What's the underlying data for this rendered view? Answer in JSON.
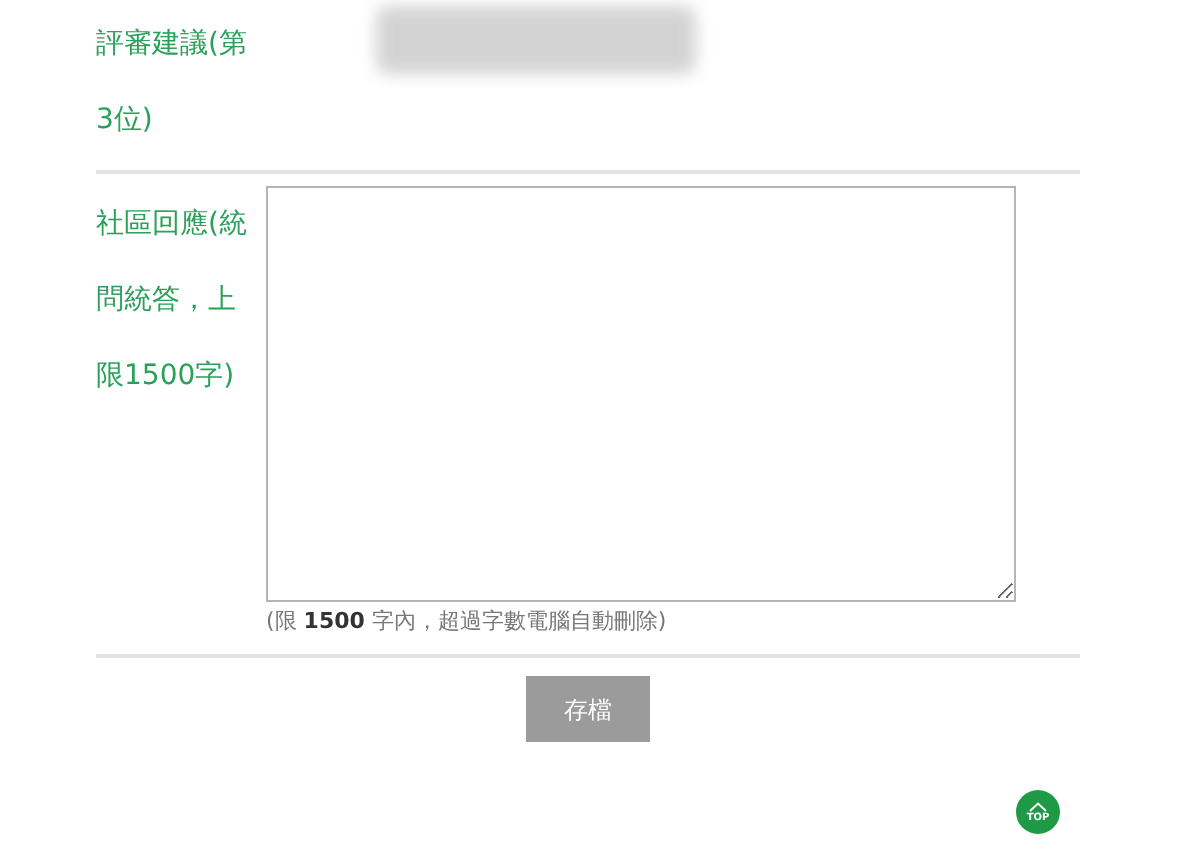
{
  "review": {
    "label": "評審建議(第3位)"
  },
  "response": {
    "label": "社區回應(統問統答，上限1500字)",
    "hint": "(限 **1500** 字內，超過字數電腦自動刪除)"
  },
  "save_button": "存檔",
  "top_button": "TOP"
}
